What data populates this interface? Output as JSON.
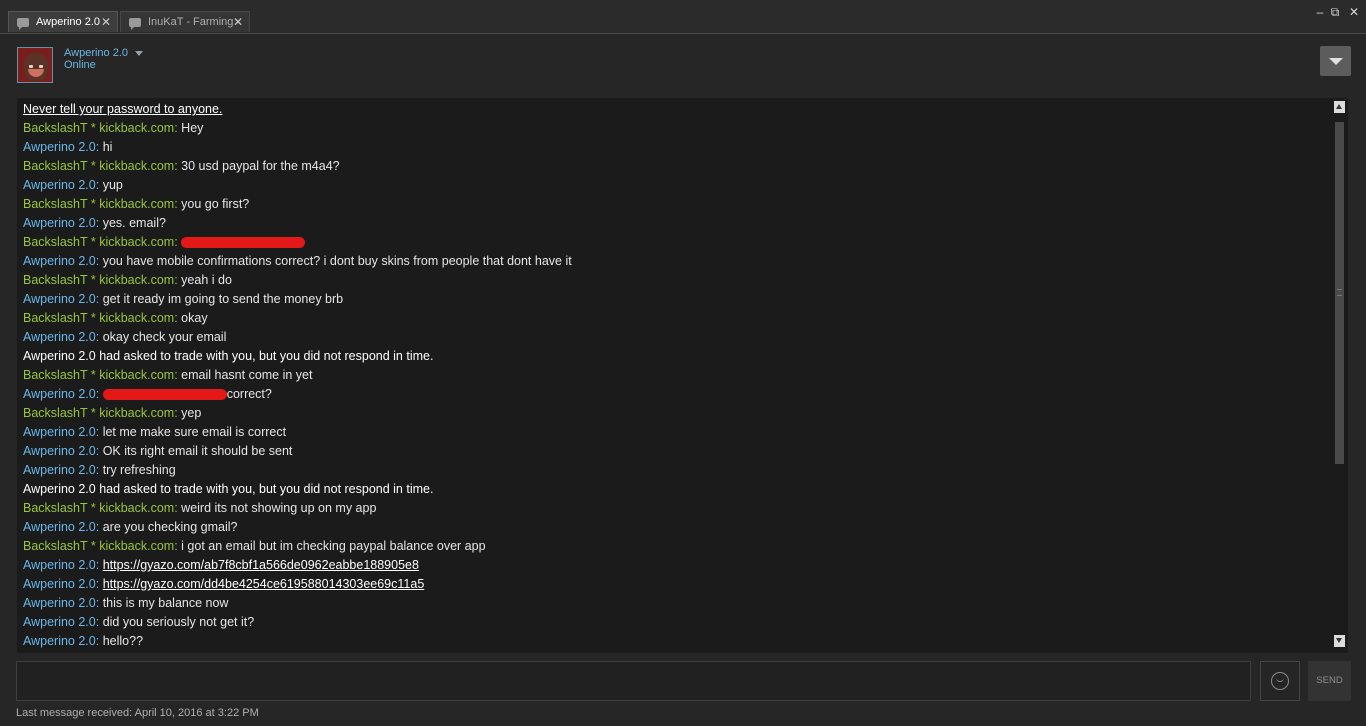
{
  "tabs": [
    {
      "label": "Awperino 2.0",
      "active": true
    },
    {
      "label": "InuKaT - Farming",
      "active": false
    }
  ],
  "window_controls": {
    "minimize": "–",
    "restore": "⧉",
    "close": "✕"
  },
  "header": {
    "name": "Awperino 2.0",
    "status": "Online"
  },
  "chat": {
    "notice": "Never tell your password to anyone.",
    "messages": [
      {
        "type": "friend",
        "sender": "BackslashT * kickback.com",
        "text": "Hey"
      },
      {
        "type": "self",
        "sender": "Awperino 2.0",
        "text": "hi"
      },
      {
        "type": "friend",
        "sender": "BackslashT * kickback.com",
        "text": "30 usd paypal for the m4a4?"
      },
      {
        "type": "self",
        "sender": "Awperino 2.0",
        "text": "yup"
      },
      {
        "type": "friend",
        "sender": "BackslashT * kickback.com",
        "text": "you go first?"
      },
      {
        "type": "self",
        "sender": "Awperino 2.0",
        "text": "yes. email?"
      },
      {
        "type": "friend",
        "sender": "BackslashT * kickback.com",
        "text": "",
        "redacted": true,
        "redact_width": 124
      },
      {
        "type": "self",
        "sender": "Awperino 2.0",
        "text": "you have mobile confirmations correct? i dont buy skins from people that dont have it"
      },
      {
        "type": "friend",
        "sender": "BackslashT * kickback.com",
        "text": "yeah i do"
      },
      {
        "type": "self",
        "sender": "Awperino 2.0",
        "text": "get it ready im going to send the money brb"
      },
      {
        "type": "friend",
        "sender": "BackslashT * kickback.com",
        "text": "okay"
      },
      {
        "type": "self",
        "sender": "Awperino 2.0",
        "text": "okay check your email"
      },
      {
        "type": "system",
        "text": "Awperino 2.0 had asked to trade with you, but you did not respond in time."
      },
      {
        "type": "friend",
        "sender": "BackslashT * kickback.com",
        "text": "email hasnt come in yet"
      },
      {
        "type": "self",
        "sender": "Awperino 2.0",
        "text": "correct?",
        "redacted": true,
        "redact_width": 124
      },
      {
        "type": "friend",
        "sender": "BackslashT * kickback.com",
        "text": "yep"
      },
      {
        "type": "self",
        "sender": "Awperino 2.0",
        "text": "let me make sure email is correct"
      },
      {
        "type": "self",
        "sender": "Awperino 2.0",
        "text": "OK its right email it should be sent"
      },
      {
        "type": "self",
        "sender": "Awperino 2.0",
        "text": "try refreshing"
      },
      {
        "type": "system",
        "text": "Awperino 2.0 had asked to trade with you, but you did not respond in time."
      },
      {
        "type": "friend",
        "sender": "BackslashT * kickback.com",
        "text": "weird its not showing up on my app"
      },
      {
        "type": "self",
        "sender": "Awperino 2.0",
        "text": "are you checking gmail?"
      },
      {
        "type": "friend",
        "sender": "BackslashT * kickback.com",
        "text": "i got an email but im checking paypal balance over app"
      },
      {
        "type": "self",
        "sender": "Awperino 2.0",
        "text": "https://gyazo.com/ab7f8cbf1a566de0962eabbe188905e8",
        "link": true
      },
      {
        "type": "self",
        "sender": "Awperino 2.0",
        "text": "https://gyazo.com/dd4be4254ce619588014303ee69c11a5",
        "link": true
      },
      {
        "type": "self",
        "sender": "Awperino 2.0",
        "text": "this is my balance now"
      },
      {
        "type": "self",
        "sender": "Awperino 2.0",
        "text": "did you seriously not get it?"
      },
      {
        "type": "self",
        "sender": "Awperino 2.0",
        "text": "hello??"
      }
    ]
  },
  "composer": {
    "input_value": "",
    "send_label": "SEND"
  },
  "footer": {
    "last_message": "Last message received: April 10, 2016 at 3:22 PM"
  },
  "colors": {
    "self_name": "#6ab8ea",
    "friend_name": "#97c540",
    "redaction": "#e31818"
  }
}
